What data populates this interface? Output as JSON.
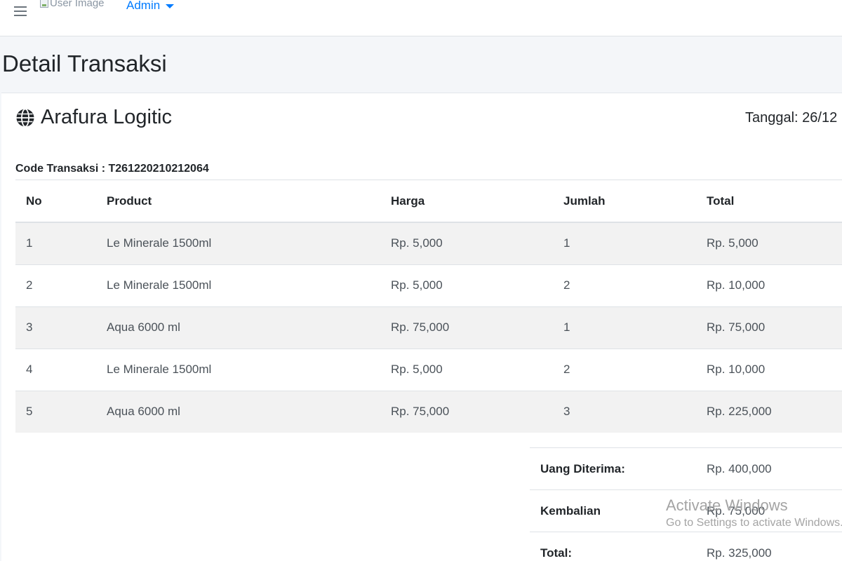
{
  "navbar": {
    "user_image_alt": "User Image",
    "user_name": "Admin"
  },
  "page": {
    "title": "Detail Transaksi"
  },
  "invoice": {
    "company": "Arafura Logitic",
    "date_label": "Tanggal: 26/12",
    "code_label": "Code Transaksi : T261220210212064",
    "columns": [
      "No",
      "Product",
      "Harga",
      "Jumlah",
      "Total"
    ],
    "rows": [
      {
        "no": "1",
        "product": "Le Minerale 1500ml",
        "harga": "Rp. 5,000",
        "jumlah": "1",
        "total": "Rp. 5,000"
      },
      {
        "no": "2",
        "product": "Le Minerale 1500ml",
        "harga": "Rp. 5,000",
        "jumlah": "2",
        "total": "Rp. 10,000"
      },
      {
        "no": "3",
        "product": "Aqua 6000 ml",
        "harga": "Rp. 75,000",
        "jumlah": "1",
        "total": "Rp. 75,000"
      },
      {
        "no": "4",
        "product": "Le Minerale 1500ml",
        "harga": "Rp. 5,000",
        "jumlah": "2",
        "total": "Rp. 10,000"
      },
      {
        "no": "5",
        "product": "Aqua 6000 ml",
        "harga": "Rp. 75,000",
        "jumlah": "3",
        "total": "Rp. 225,000"
      }
    ],
    "summary": {
      "received_label": "Uang Diterima:",
      "received_value": "Rp. 400,000",
      "change_label": "Kembalian",
      "change_value": "Rp. 75,000",
      "total_label": "Total:",
      "total_value": "Rp. 325,000"
    }
  },
  "watermark": {
    "title": "Activate Windows",
    "subtitle": "Go to Settings to activate Windows."
  },
  "colors": {
    "accent": "#007bff",
    "background": "#f4f6f9",
    "stripe": "#f2f2f2"
  },
  "icons": [
    "menu-icon",
    "broken-image-icon",
    "caret-down-icon",
    "globe-icon"
  ]
}
